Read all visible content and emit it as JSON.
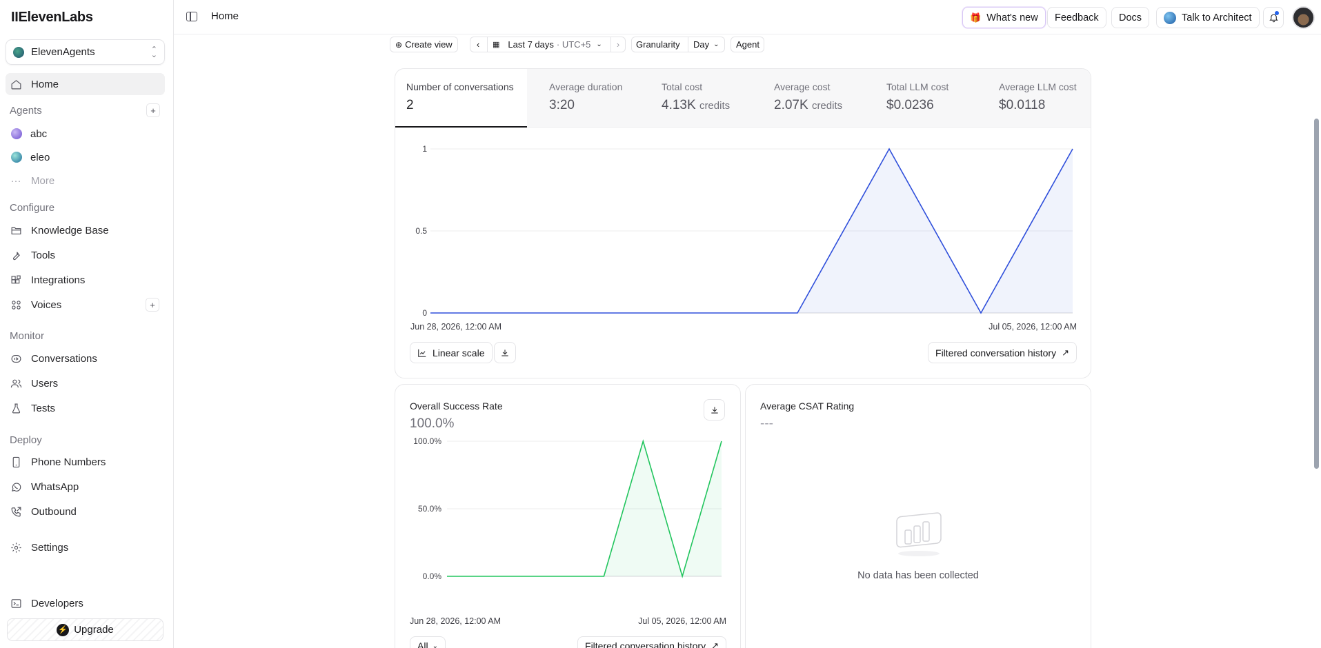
{
  "app": {
    "logo": "IIElevenLabs",
    "workspace": "ElevenAgents"
  },
  "sidebar": {
    "home": "Home",
    "agents_label": "Agents",
    "agents": [
      {
        "name": "abc",
        "color": "#7c6fd6"
      },
      {
        "name": "eleo",
        "color": "#1fa0a0"
      }
    ],
    "more": "More",
    "configure_label": "Configure",
    "configure": [
      "Knowledge Base",
      "Tools",
      "Integrations",
      "Voices"
    ],
    "monitor_label": "Monitor",
    "monitor": [
      "Conversations",
      "Users",
      "Tests"
    ],
    "deploy_label": "Deploy",
    "deploy": [
      "Phone Numbers",
      "WhatsApp",
      "Outbound"
    ],
    "settings": "Settings",
    "developers": "Developers",
    "upgrade": "Upgrade"
  },
  "topbar": {
    "breadcrumb": "Home",
    "whats_new": "What's new",
    "feedback": "Feedback",
    "docs": "Docs",
    "talk_to_architect": "Talk to Architect"
  },
  "filters": {
    "create_view": "Create view",
    "date_range": "Last 7 days",
    "timezone": "· UTC+5",
    "granularity_label": "Granularity",
    "granularity_value": "Day",
    "agent": "Agent"
  },
  "metrics": [
    {
      "label": "Number of conversations",
      "value": "2",
      "unit": ""
    },
    {
      "label": "Average duration",
      "value": "3:20",
      "unit": ""
    },
    {
      "label": "Total cost",
      "value": "4.13K",
      "unit": "credits"
    },
    {
      "label": "Average cost",
      "value": "2.07K",
      "unit": "credits"
    },
    {
      "label": "Total LLM cost",
      "value": "$0.0236",
      "unit": ""
    },
    {
      "label": "Average LLM cost",
      "value": "$0.0118",
      "unit": ""
    }
  ],
  "main_chart": {
    "x_start": "Jun 28, 2026, 12:00 AM",
    "x_end": "Jul 05, 2026, 12:00 AM",
    "linear_scale": "Linear scale",
    "history_link": "Filtered conversation history"
  },
  "success_card": {
    "title": "Overall Success Rate",
    "value": "100.0%",
    "x_start": "Jun 28, 2026, 12:00 AM",
    "x_end": "Jul 05, 2026, 12:00 AM",
    "filter": "All",
    "history_link": "Filtered conversation history"
  },
  "csat_card": {
    "title": "Average CSAT Rating",
    "value": "---",
    "empty": "No data has been collected"
  },
  "chart_data": [
    {
      "type": "area",
      "x": [
        "Jun 28",
        "Jun 29",
        "Jun 30",
        "Jul 01",
        "Jul 02",
        "Jul 03",
        "Jul 04",
        "Jul 05"
      ],
      "values": [
        0,
        0,
        0,
        0,
        0,
        1,
        0,
        1
      ],
      "yticks": [
        "0",
        "0.5",
        "1"
      ],
      "ylim": [
        0,
        1
      ],
      "color": "#2f4fdb"
    },
    {
      "type": "area",
      "title": "Overall Success Rate",
      "x": [
        "Jun 28",
        "Jun 29",
        "Jun 30",
        "Jul 01",
        "Jul 02",
        "Jul 03",
        "Jul 04",
        "Jul 05"
      ],
      "values": [
        0,
        0,
        0,
        0,
        0,
        100,
        0,
        100
      ],
      "yticks": [
        "0.0%",
        "50.0%",
        "100.0%"
      ],
      "ylim": [
        0,
        100
      ],
      "color": "#22c55e"
    }
  ]
}
